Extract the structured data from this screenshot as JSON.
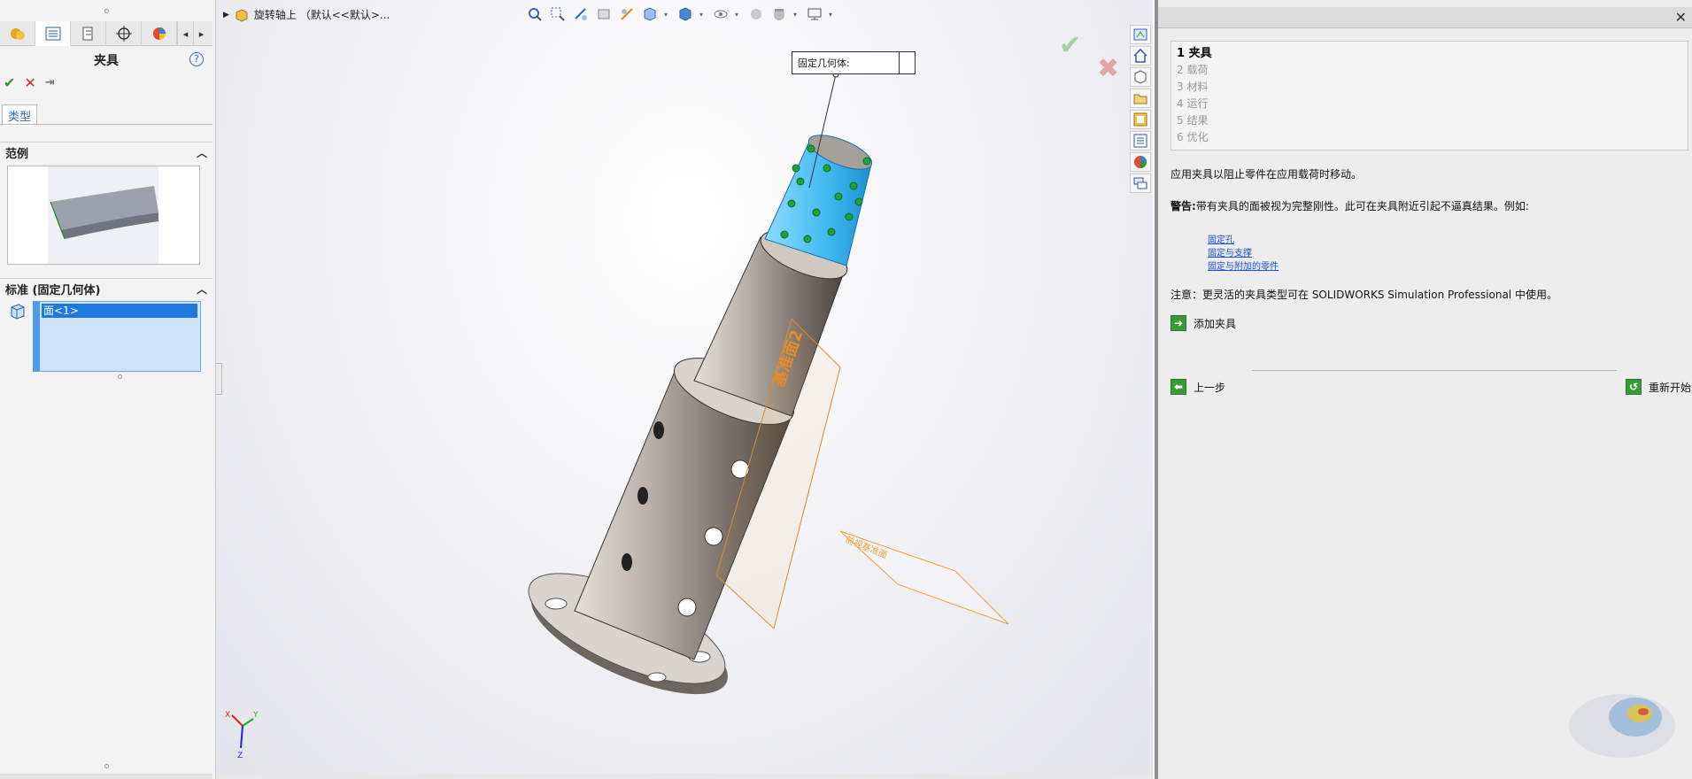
{
  "left_panel": {
    "title": "夹具",
    "help": "?",
    "ok": "✔",
    "cancel": "✕",
    "pin": "⇥",
    "type_tab": "类型",
    "section_example": "范例",
    "section_standard": "标准 (固定几何体)",
    "selection_item": "面<1>",
    "tab_prev": "◂",
    "tab_next": "▸"
  },
  "viewport": {
    "document_title": "旋转轴上 （默认<<默认>...",
    "callout_label": "固定几何体:",
    "plane_label_1": "基准面2",
    "plane_label_2": "前视基准面",
    "triad_x": "X",
    "triad_y": "Y",
    "triad_z": "Z"
  },
  "right_panel": {
    "steps": [
      {
        "num": "1",
        "label": "夹具"
      },
      {
        "num": "2",
        "label": "载荷"
      },
      {
        "num": "3",
        "label": "材料"
      },
      {
        "num": "4",
        "label": "运行"
      },
      {
        "num": "5",
        "label": "结果"
      },
      {
        "num": "6",
        "label": "优化"
      }
    ],
    "intro": "应用夹具以阻止零件在应用载荷时移动。",
    "warning_label": "警告:",
    "warning_text": "带有夹具的面被视为完整刚性。此可在夹具附近引起不逼真结果。例如:",
    "links": [
      "固定孔",
      "固定与支撑",
      "固定与附加的零件"
    ],
    "note": "注意：更灵活的夹具类型可在  SOLIDWORKS Simulation Professional 中使用。",
    "add_fixture": "添加夹具",
    "prev_step": "上一步",
    "restart": "重新开始"
  },
  "colors": {
    "selected_face": "#3fb8f0",
    "fixture_arrows": "#1fa13a",
    "plane_outline": "#f0a040",
    "body": "#7d736c",
    "link": "#1c4fd6"
  }
}
